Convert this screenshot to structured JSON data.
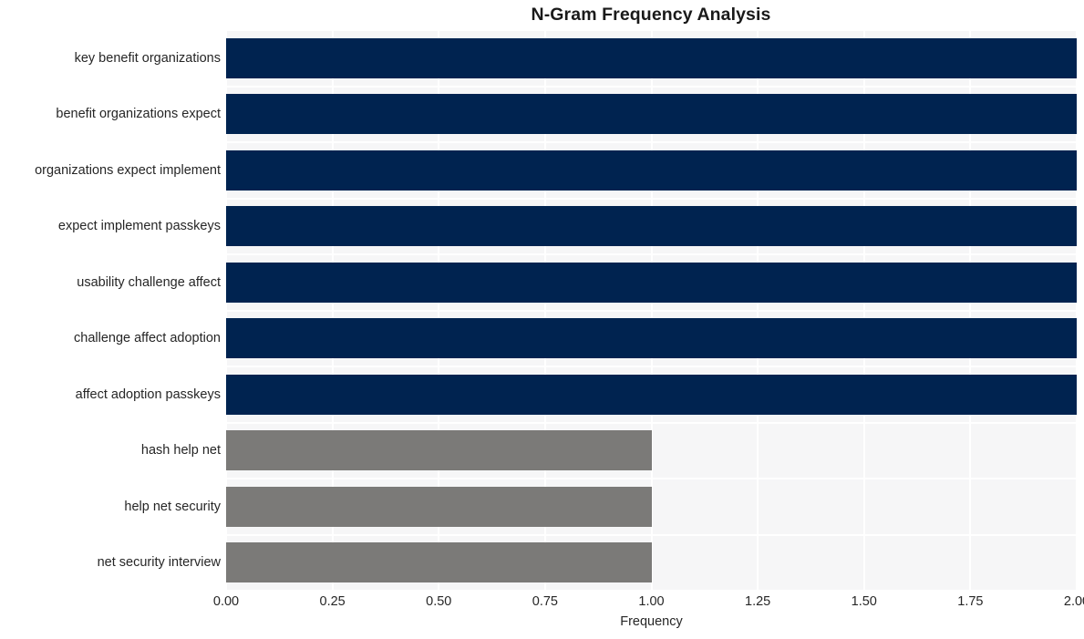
{
  "chart_data": {
    "type": "bar",
    "orientation": "horizontal",
    "title": "N-Gram Frequency Analysis",
    "xlabel": "Frequency",
    "ylabel": "",
    "xlim": [
      0.0,
      2.0
    ],
    "xticks": [
      "0.00",
      "0.25",
      "0.50",
      "0.75",
      "1.00",
      "1.25",
      "1.50",
      "1.75",
      "2.00"
    ],
    "xtick_values": [
      0.0,
      0.25,
      0.5,
      0.75,
      1.0,
      1.25,
      1.5,
      1.75,
      2.0
    ],
    "grid": true,
    "grid_color": "#ffffff",
    "plot_background": "#f6f6f7",
    "figure_background": "#ffffff",
    "legend": null,
    "categories": [
      "key benefit organizations",
      "benefit organizations expect",
      "organizations expect implement",
      "expect implement passkeys",
      "usability challenge affect",
      "challenge affect adoption",
      "affect adoption passkeys",
      "hash help net",
      "help net security",
      "net security interview"
    ],
    "values": [
      2,
      2,
      2,
      2,
      2,
      2,
      2,
      1,
      1,
      1
    ],
    "bar_colors": [
      "#002350",
      "#002350",
      "#002350",
      "#002350",
      "#002350",
      "#002350",
      "#002350",
      "#7b7a78",
      "#7b7a78",
      "#7b7a78"
    ],
    "colors": {
      "high_frequency": "#002350",
      "low_frequency": "#7b7a78",
      "text": "#262626",
      "title": "#1a1a1a"
    }
  }
}
